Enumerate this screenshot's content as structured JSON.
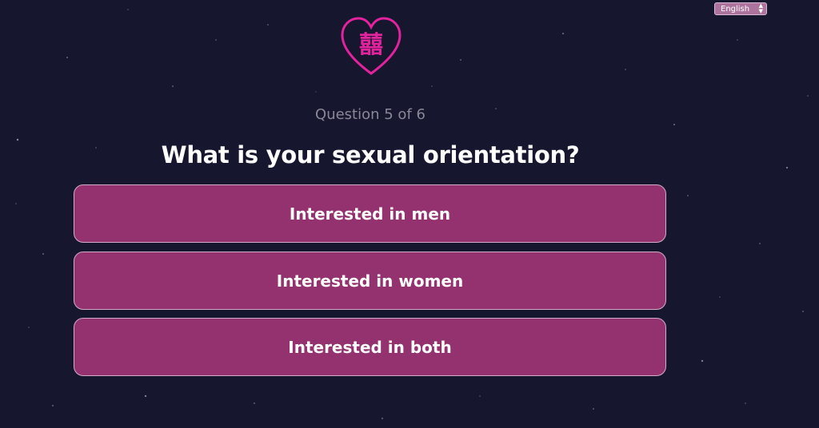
{
  "language_selector": {
    "selected": "English",
    "arrows_icon": "updown-arrows-icon"
  },
  "logo": {
    "glyph": "囍",
    "icon": "heart-double-happiness-icon",
    "color": "#e2239d"
  },
  "quiz": {
    "progress": "Question 5 of 6",
    "question": "What is your sexual orientation?",
    "options": [
      {
        "label": "Interested in men"
      },
      {
        "label": "Interested in women"
      },
      {
        "label": "Interested in both"
      }
    ]
  },
  "colors": {
    "background": "#17162f",
    "option_fill": "#93326f",
    "option_border": "#d3adc9",
    "muted_text": "#8a8797"
  }
}
